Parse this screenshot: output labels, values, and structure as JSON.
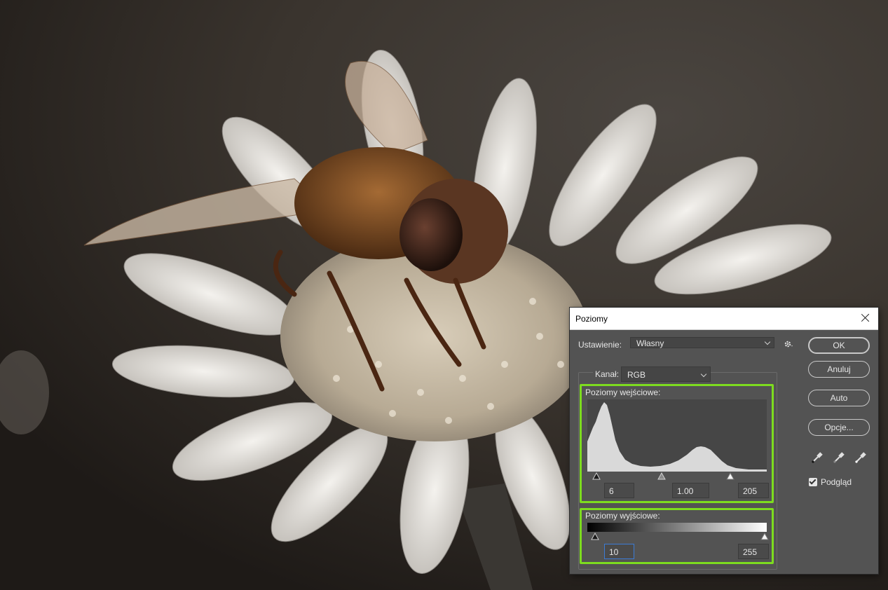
{
  "dialog": {
    "title": "Poziomy",
    "preset_label": "Ustawienie:",
    "preset_value": "Własny",
    "channel_label": "Kanał:",
    "channel_value": "RGB",
    "input_levels_label": "Poziomy wejściowe:",
    "input_black": "6",
    "input_gamma": "1.00",
    "input_white": "205",
    "output_levels_label": "Poziomy wyjściowe:",
    "output_black": "10",
    "output_white": "255",
    "buttons": {
      "ok": "OK",
      "cancel": "Anuluj",
      "auto": "Auto",
      "options": "Opcje..."
    },
    "preview_label": "Podgląd",
    "preview_checked": true
  },
  "colors": {
    "highlight": "#7ddc1f",
    "dialog_bg": "#535353",
    "histogram": "#d9d9d9"
  },
  "icons": [
    "close-icon",
    "gear-icon",
    "black-eyedropper-icon",
    "gray-eyedropper-icon",
    "white-eyedropper-icon",
    "chevron-down-icon"
  ]
}
